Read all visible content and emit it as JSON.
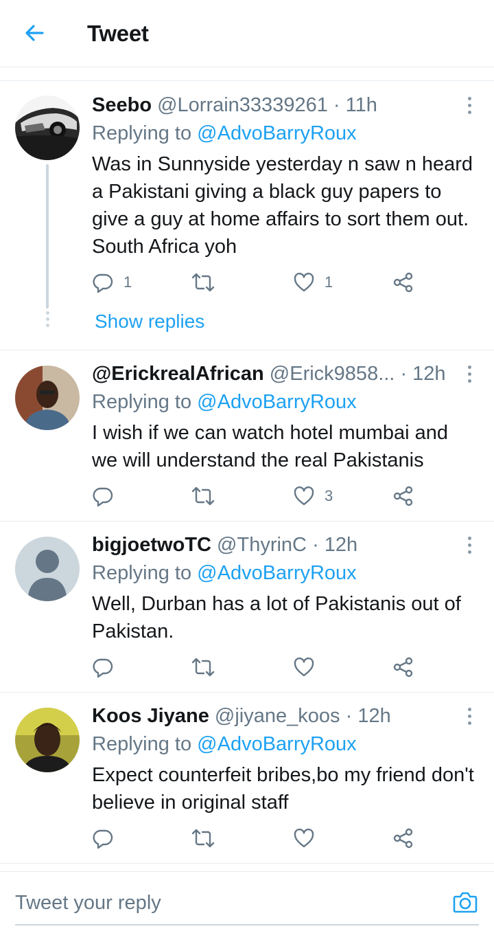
{
  "header": {
    "title": "Tweet",
    "back_icon": "arrow-left-icon",
    "accent": "#1da1f2"
  },
  "tweets": [
    {
      "name": "Seebo",
      "handle": "@Lorrain33339261",
      "dot": "·",
      "time": "11h",
      "replying_prefix": "Replying to",
      "replying_to": "@AdvoBarryRoux",
      "text": "Was in Sunnyside yesterday n saw n heard a Pakistani giving a black guy papers to give a guy at home affairs to sort them out. South Africa yoh",
      "reply_count": "1",
      "retweet_count": "",
      "like_count": "1",
      "show_replies": "Show replies"
    },
    {
      "name": "@ErickrealAfrican",
      "handle": "@Erick9858...",
      "dot": "·",
      "time": "12h",
      "replying_prefix": "Replying to",
      "replying_to": "@AdvoBarryRoux",
      "text": "I wish if we can watch hotel mumbai and we will understand the real Pakistanis",
      "reply_count": "",
      "retweet_count": "",
      "like_count": "3"
    },
    {
      "name": "bigjoetwoTC",
      "handle": "@ThyrinC",
      "dot": "·",
      "time": "12h",
      "replying_prefix": "Replying to",
      "replying_to": "@AdvoBarryRoux",
      "text": "Well, Durban has a lot of Pakistanis out of Pakistan.",
      "reply_count": "",
      "retweet_count": "",
      "like_count": ""
    },
    {
      "name": "Koos Jiyane",
      "handle": "@jiyane_koos",
      "dot": "·",
      "time": "12h",
      "replying_prefix": "Replying to",
      "replying_to": "@AdvoBarryRoux",
      "text": "Expect counterfeit bribes,bo my friend don't believe in original staff",
      "reply_count": "",
      "retweet_count": "",
      "like_count": ""
    }
  ],
  "composer": {
    "placeholder": "Tweet your reply",
    "camera_icon": "camera-icon"
  },
  "icons": {
    "reply": "reply-icon",
    "retweet": "retweet-icon",
    "like": "heart-icon",
    "share": "share-icon",
    "more": "more-vertical-icon"
  }
}
